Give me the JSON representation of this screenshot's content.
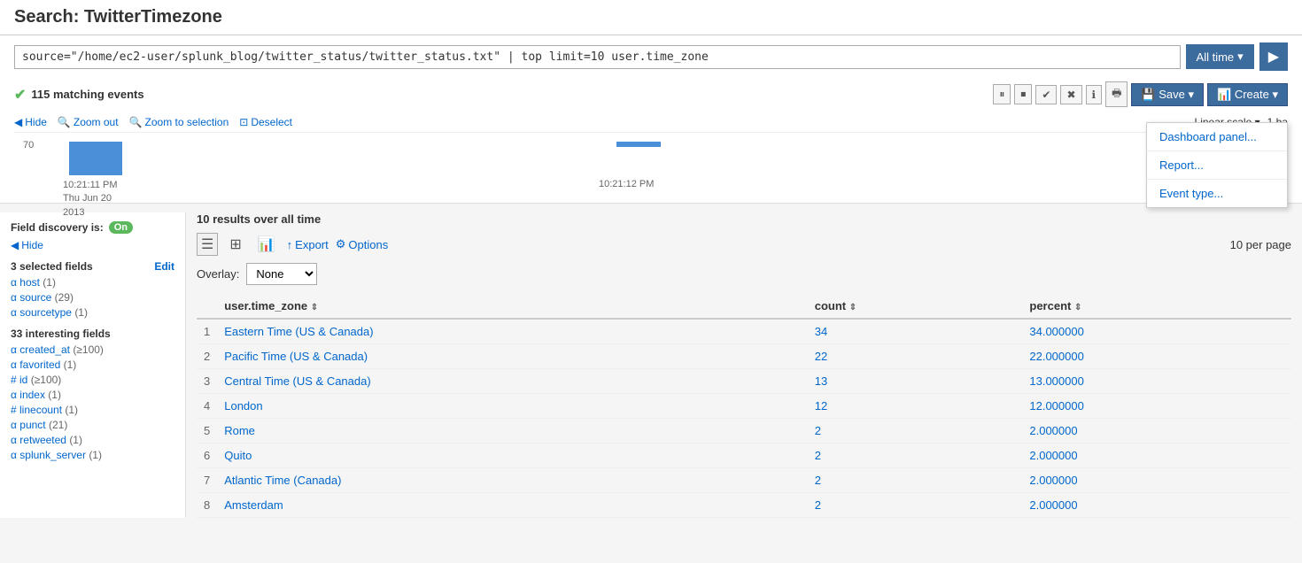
{
  "page": {
    "title": "Search: TwitterTimezone"
  },
  "search": {
    "query": "source=\"/home/ec2-user/splunk_blog/twitter_status/twitter_status.txt\" | top limit=10 user.time_zone",
    "time_range": "All time",
    "matching_events": "115 matching events"
  },
  "toolbar": {
    "save_label": "Save",
    "create_label": "Create",
    "save_icon": "💾",
    "create_icon": "📊"
  },
  "timeline": {
    "y_value": "70",
    "x_label1_line1": "10:21:11 PM",
    "x_label1_line2": "Thu Jun 20",
    "x_label1_line3": "2013",
    "x_label2": "10:21:12 PM",
    "controls": {
      "hide": "Hide",
      "zoom_out": "Zoom out",
      "zoom_to_selection": "Zoom to selection",
      "deselect": "Deselect"
    },
    "scale": "Linear scale",
    "bar_label": "1 ba"
  },
  "dropdown_menu": {
    "items": [
      "Dashboard panel...",
      "Report...",
      "Event type..."
    ]
  },
  "sidebar": {
    "field_discovery_label": "Field discovery is:",
    "on_label": "On",
    "hide_label": "Hide",
    "selected_fields_header": "3 selected fields",
    "edit_label": "Edit",
    "selected_fields": [
      {
        "name": "host",
        "type": "alpha",
        "count": "(1)"
      },
      {
        "name": "source",
        "type": "alpha",
        "count": "(29)"
      },
      {
        "name": "sourcetype",
        "type": "alpha",
        "count": "(1)"
      }
    ],
    "interesting_fields_header": "33 interesting fields",
    "interesting_fields": [
      {
        "name": "created_at",
        "type": "alpha",
        "count": "(≥100)"
      },
      {
        "name": "favorited",
        "type": "alpha",
        "count": "(1)"
      },
      {
        "name": "id",
        "type": "hash",
        "count": "(≥100)"
      },
      {
        "name": "index",
        "type": "alpha",
        "count": "(1)"
      },
      {
        "name": "linecount",
        "type": "hash",
        "count": "(1)"
      },
      {
        "name": "punct",
        "type": "alpha",
        "count": "(21)"
      },
      {
        "name": "retweeted",
        "type": "alpha",
        "count": "(1)"
      },
      {
        "name": "splunk_server",
        "type": "alpha",
        "count": "(1)"
      }
    ]
  },
  "results": {
    "summary": "10 results over all time",
    "per_page": "10 per page",
    "overlay_label": "Overlay:",
    "overlay_value": "None",
    "columns": {
      "timezone": "user.time_zone",
      "count": "count",
      "percent": "percent"
    },
    "rows": [
      {
        "num": "1",
        "timezone": "Eastern Time (US & Canada)",
        "count": "34",
        "percent": "34.000000"
      },
      {
        "num": "2",
        "timezone": "Pacific Time (US & Canada)",
        "count": "22",
        "percent": "22.000000"
      },
      {
        "num": "3",
        "timezone": "Central Time (US & Canada)",
        "count": "13",
        "percent": "13.000000"
      },
      {
        "num": "4",
        "timezone": "London",
        "count": "12",
        "percent": "12.000000"
      },
      {
        "num": "5",
        "timezone": "Rome",
        "count": "2",
        "percent": "2.000000"
      },
      {
        "num": "6",
        "timezone": "Quito",
        "count": "2",
        "percent": "2.000000"
      },
      {
        "num": "7",
        "timezone": "Atlantic Time (Canada)",
        "count": "2",
        "percent": "2.000000"
      },
      {
        "num": "8",
        "timezone": "Amsterdam",
        "count": "2",
        "percent": "2.000000"
      }
    ]
  }
}
